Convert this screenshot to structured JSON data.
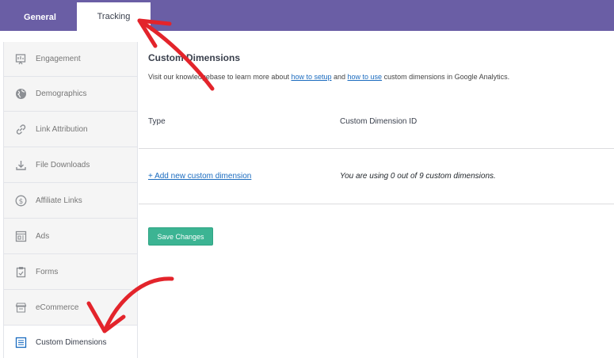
{
  "tabs": {
    "general": "General",
    "tracking": "Tracking"
  },
  "sidebar": {
    "items": [
      {
        "label": "Engagement",
        "icon": "engagement-icon"
      },
      {
        "label": "Demographics",
        "icon": "globe-icon"
      },
      {
        "label": "Link Attribution",
        "icon": "link-icon"
      },
      {
        "label": "File Downloads",
        "icon": "download-icon"
      },
      {
        "label": "Affiliate Links",
        "icon": "dollar-icon"
      },
      {
        "label": "Ads",
        "icon": "ads-icon"
      },
      {
        "label": "Forms",
        "icon": "clipboard-icon"
      },
      {
        "label": "eCommerce",
        "icon": "store-icon"
      },
      {
        "label": "Custom Dimensions",
        "icon": "list-icon",
        "active": true
      }
    ]
  },
  "main": {
    "title": "Custom Dimensions",
    "desc_before": "Visit our knowledgebase to learn more about ",
    "link_setup": "how to setup",
    "desc_and": " and ",
    "link_use": "how to use",
    "desc_after": " custom dimensions in Google Analytics.",
    "col_type": "Type",
    "col_id": "Custom Dimension ID",
    "add_link": "+ Add new custom dimension",
    "usage": "You are using 0 out of 9 custom dimensions.",
    "save": "Save Changes"
  },
  "colors": {
    "header": "#6a5ea5",
    "accent": "#3cb493",
    "link": "#1a6bbf",
    "annotation": "#e3242b"
  }
}
